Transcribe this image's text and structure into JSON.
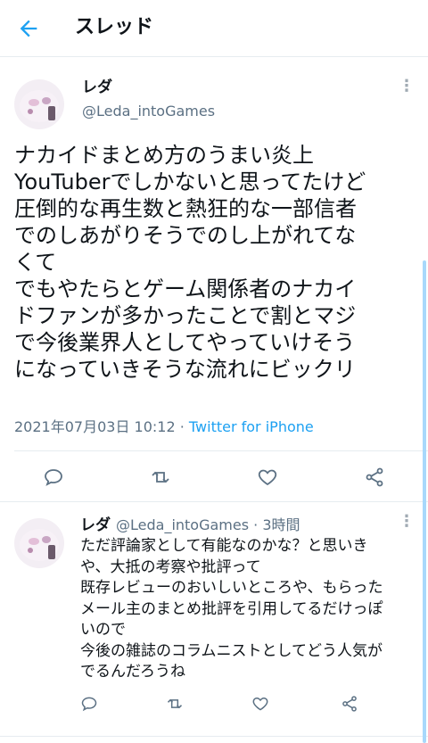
{
  "header": {
    "title": "スレッド"
  },
  "main_tweet": {
    "name": "レダ",
    "handle": "@Leda_intoGames",
    "text": "ナカイドまとめ方のうまい炎上\nYouTuberでしかないと思ってたけど\n圧倒的な再生数と熱狂的な一部信者\nでのしあがりそうでのし上がれてな\nくて\nでもやたらとゲーム関係者のナカイ\nドファンが多かったことで割とマジ\nで今後業界人としてやっていけそう\nになっていきそうな流れにビックリ",
    "timestamp": "2021年07月03日 10:12",
    "separator": "·",
    "source": "Twitter for iPhone"
  },
  "reply_tweet": {
    "name": "レダ",
    "handle": "@Leda_intoGames",
    "separator": "·",
    "time": "3時間",
    "text": "ただ評論家として有能なのかな？と思いき\nや、大抵の考察や批評って\n既存レビューのおいしいところや、もらった\nメール主のまとめ批評を引用してるだけっぽ\nいので\n今後の雑誌のコラムニストとしてどう人気が\nでるんだろうね"
  },
  "colors": {
    "accent": "#1da1f2",
    "secondary_text": "#5b7083",
    "divider": "#e6ecf0"
  },
  "icons": {
    "back": "arrow-left-icon",
    "more": "more-vertical-icon",
    "reply": "reply-icon",
    "retweet": "retweet-icon",
    "like": "heart-icon",
    "share": "share-icon"
  }
}
